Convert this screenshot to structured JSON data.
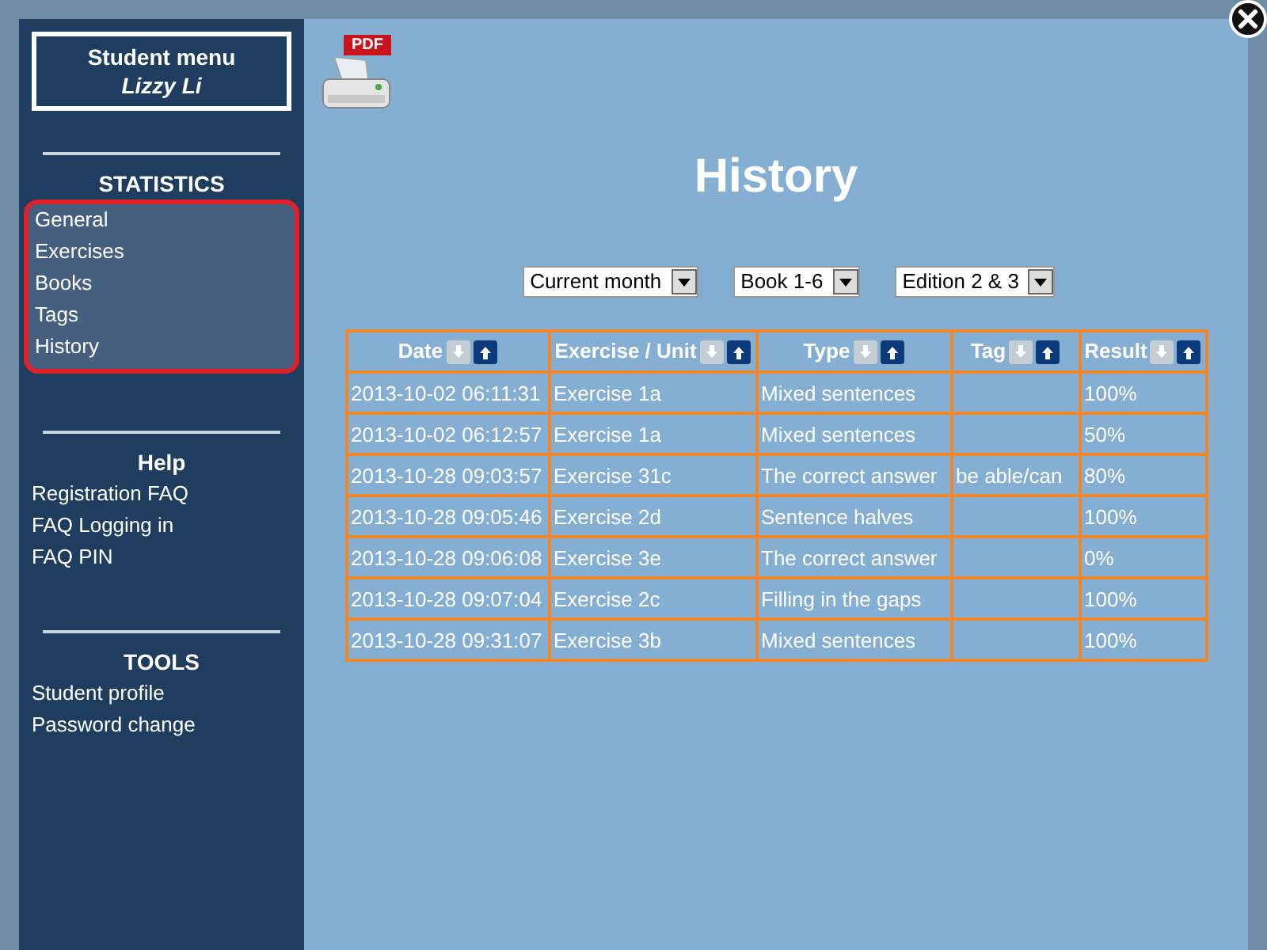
{
  "sidebar": {
    "header": {
      "title": "Student menu",
      "user": "Lizzy Li"
    },
    "sections": [
      {
        "title": "STATISTICS",
        "highlighted": true,
        "items": [
          "General",
          "Exercises",
          "Books",
          "Tags",
          "History"
        ]
      },
      {
        "title": "Help",
        "highlighted": false,
        "items": [
          "Registration FAQ",
          "FAQ Logging in",
          "FAQ PIN"
        ]
      },
      {
        "title": "TOOLS",
        "highlighted": false,
        "items": [
          "Student profile",
          "Password change"
        ]
      }
    ]
  },
  "pdf_badge": "PDF",
  "title": "History",
  "filters": [
    {
      "value": "Current month"
    },
    {
      "value": "Book 1-6"
    },
    {
      "value": "Edition 2 & 3"
    }
  ],
  "table": {
    "columns": [
      "Date",
      "Exercise / Unit",
      "Type",
      "Tag",
      "Result"
    ],
    "rows": [
      [
        "2013-10-02 06:11:31",
        "Exercise 1a",
        "Mixed sentences",
        "",
        "100%"
      ],
      [
        "2013-10-02 06:12:57",
        "Exercise 1a",
        "Mixed sentences",
        "",
        "50%"
      ],
      [
        "2013-10-28 09:03:57",
        "Exercise 31c",
        "The correct answer",
        "be able/can",
        "80%"
      ],
      [
        "2013-10-28 09:05:46",
        "Exercise 2d",
        "Sentence halves",
        "",
        "100%"
      ],
      [
        "2013-10-28 09:06:08",
        "Exercise 3e",
        "The correct answer",
        "",
        "0%"
      ],
      [
        "2013-10-28 09:07:04",
        "Exercise 2c",
        "Filling in the gaps",
        "",
        "100%"
      ],
      [
        "2013-10-28 09:31:07",
        "Exercise 3b",
        "Mixed sentences",
        "",
        "100%"
      ]
    ]
  }
}
